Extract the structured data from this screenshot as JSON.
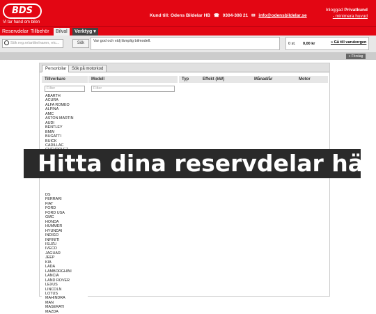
{
  "header": {
    "logo": "BDS",
    "slogan": "Vi tar hand om bilen",
    "contact": {
      "customer": "Kund till: Odens Bildelar HB",
      "phone": "0304-308 21",
      "email": "info@odensbildelar.se"
    },
    "user": {
      "login_prefix": "Inloggad",
      "name": "Privatkund",
      "minimize": "- minimera huvud"
    }
  },
  "nav": {
    "items": [
      "Reservdelar",
      "Tillbehör",
      "Bilval",
      "Verktyg"
    ],
    "active": "Bilval"
  },
  "toolbar": {
    "search_placeholder": "Sök reg.nr/artikelnamn, etc...",
    "search_button": "Sök",
    "message": "Var god och välj lämplig bilmodell.",
    "cart_qty": "0 st.",
    "cart_amount": "0,00 kr",
    "cart_add": "» Gå till varukorgen",
    "suggest_button": "» Förslag"
  },
  "panel": {
    "tabs": [
      "Personbilar",
      "Sök på motorkod"
    ],
    "manufacturer_header": "Tillverkare",
    "model_header": "Modell",
    "filter_placeholder": "Filter",
    "type_columns": [
      "Typ",
      "Effekt (kW)",
      "Månad/år",
      "Motor"
    ],
    "manufacturers_top": [
      "ABARTH",
      "ACURA",
      "ALFA ROMEO",
      "ALPINA",
      "AMC",
      "ASTON MARTIN",
      "AUDI",
      "BENTLEY",
      "BMW",
      "BUGATTI",
      "BUICK",
      "CADILLAC",
      "CHEVROLET"
    ],
    "manufacturers_bottom": [
      "DS",
      "FERRARI",
      "FIAT",
      "FORD",
      "FORD USA",
      "GMC",
      "HONDA",
      "HUMMER",
      "HYUNDAI",
      "INDIGO",
      "INFINITI",
      "ISUZU",
      "IVECO",
      "JAGUAR",
      "JEEP",
      "KIA",
      "LADA",
      "LAMBORGHINI",
      "LANCIA",
      "LAND ROVER",
      "LEXUS",
      "LINCOLN",
      "LOTUS",
      "MAHINDRA",
      "MAN",
      "MASERATI",
      "MAZDA"
    ]
  },
  "overlay": {
    "text": "Hitta dina reservdelar här"
  },
  "colors": {
    "brand_red": "#e30613",
    "overlay_bg": "#2a2a2a"
  }
}
